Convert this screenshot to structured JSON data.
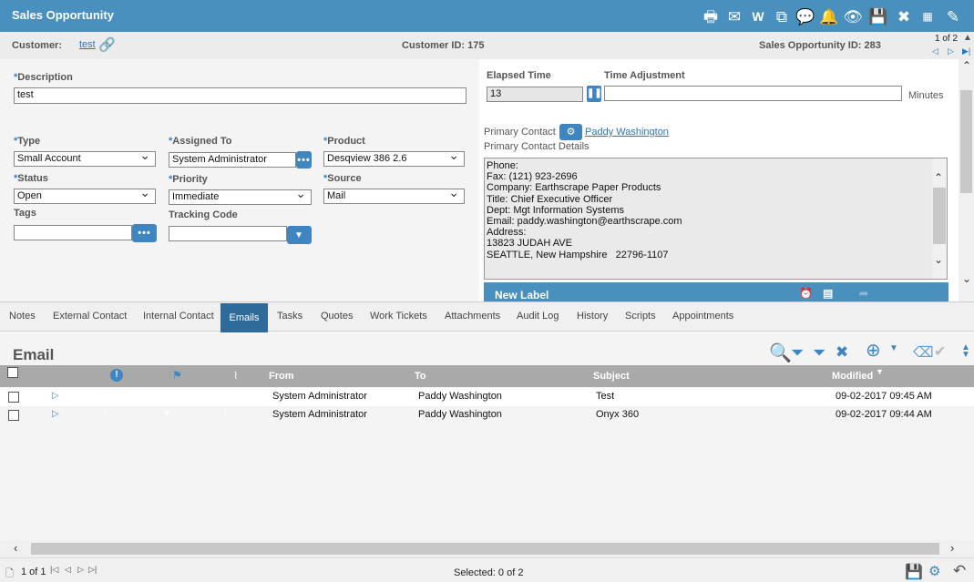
{
  "window": {
    "title": "Sales Opportunity"
  },
  "toolbar_icons": [
    "print-icon",
    "email-icon",
    "word-icon",
    "copy-icon",
    "chat-icon",
    "alert-add-icon",
    "view-icon",
    "save-icon",
    "close-icon",
    "ids-icon",
    "edit-icon"
  ],
  "info": {
    "customer_label": "Customer:",
    "customer_value": "test",
    "customer_id": "Customer ID: 175",
    "opportunity_id": "Sales Opportunity ID: 283",
    "pager": "1 of 2"
  },
  "form": {
    "description_label": "Description",
    "description_value": "test",
    "type_label": "Type",
    "type_value": "Small Account",
    "assigned_label": "Assigned To",
    "assigned_value": "System Administrator",
    "product_label": "Product",
    "product_value": "Desqview 386 2.6",
    "status_label": "Status",
    "status_value": "Open",
    "priority_label": "Priority",
    "priority_value": "Immediate",
    "source_label": "Source",
    "source_value": "Mail",
    "tags_label": "Tags",
    "tags_value": "",
    "tracking_label": "Tracking Code",
    "tracking_value": ""
  },
  "time": {
    "elapsed_label": "Elapsed Time",
    "elapsed_value": "13",
    "adjust_label": "Time Adjustment",
    "adjust_value": "",
    "minutes": "Minutes"
  },
  "contact": {
    "primary_label": "Primary Contact",
    "primary_name": "Paddy Washington",
    "details_label": "Primary Contact Details",
    "details": [
      "Phone:",
      "Fax: (121) 923-2696",
      "Company: Earthscrape Paper Products",
      "Title: Chief Executive Officer",
      "Dept: Mgt Information Systems",
      "Email: paddy.washington@earthscrape.com",
      "Address:",
      "13823 JUDAH AVE",
      "SEATTLE, New Hampshire   22796-1107"
    ],
    "new_label": "New Label"
  },
  "tabs": [
    "Notes",
    "External Contact",
    "Internal Contact",
    "Emails",
    "Tasks",
    "Quotes",
    "Work Tickets",
    "Attachments",
    "Audit Log",
    "History",
    "Scripts",
    "Appointments"
  ],
  "active_tab": "Emails",
  "grid": {
    "title": "Email",
    "columns": {
      "from": "From",
      "to": "To",
      "subject": "Subject",
      "modified": "Modified"
    },
    "rows": [
      {
        "from": "System Administrator",
        "to": "Paddy Washington",
        "subject": "Test",
        "modified": "09-02-2017 09:45 AM"
      },
      {
        "from": "System Administrator",
        "to": "Paddy Washington",
        "subject": "Onyx 360",
        "modified": "09-02-2017 09:44 AM"
      }
    ]
  },
  "footer": {
    "pager": "1 of 1",
    "selected": "Selected: 0 of 2"
  },
  "colors": {
    "accent": "#4a90bf",
    "active_tab": "#2f6b9a",
    "grid_header": "#a9a9a9"
  }
}
